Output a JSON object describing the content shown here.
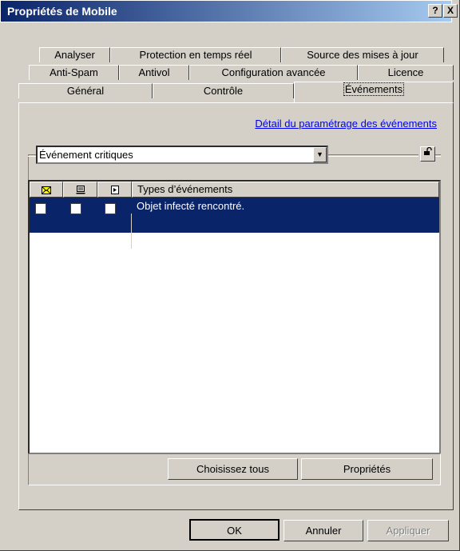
{
  "window": {
    "title": "Propriétés de Mobile",
    "help_label": "?",
    "close_label": "X"
  },
  "tabs": {
    "row1": [
      "Analyser",
      "Protection en temps réel",
      "Source des mises à jour"
    ],
    "row2": [
      "Anti-Spam",
      "Antivol",
      "Configuration avancée",
      "Licence"
    ],
    "row3": [
      "Général",
      "Contrôle",
      "Événements"
    ],
    "active": "Événements"
  },
  "pane": {
    "link": "Détail du paramétrage des événements",
    "combo_value": "Événement critiques",
    "list": {
      "col_icons": [
        "email-icon",
        "monitor-icon",
        "log-icon"
      ],
      "column_header": "Types d’événements",
      "rows": [
        {
          "text": "Objet infecté rencontré.",
          "selected": true
        }
      ]
    },
    "buttons": {
      "select_all": "Choisissez tous",
      "properties": "Propriétés"
    }
  },
  "footer": {
    "ok": "OK",
    "cancel": "Annuler",
    "apply": "Appliquer"
  },
  "colors": {
    "title_bar": "#0a246a",
    "selection": "#0a246a",
    "face": "#d4d0c8",
    "link": "#0000ee"
  }
}
